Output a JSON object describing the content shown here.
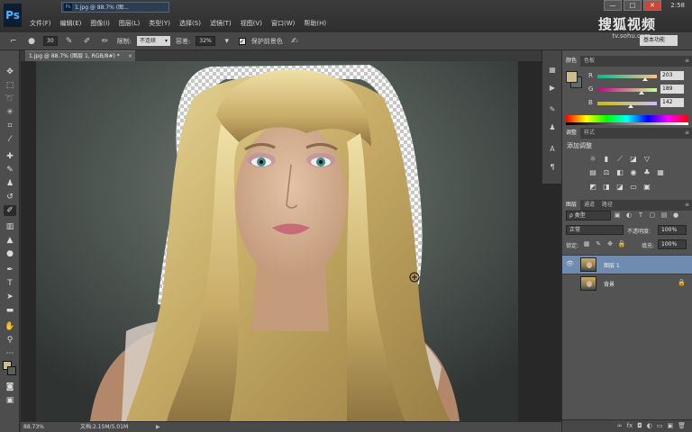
{
  "app": {
    "logo": "Ps",
    "clock": "2:58"
  },
  "menu": [
    "文件(F)",
    "编辑(E)",
    "图像(I)",
    "图层(L)",
    "类型(Y)",
    "选择(S)",
    "滤镜(T)",
    "视图(V)",
    "窗口(W)",
    "帮助(H)"
  ],
  "top_doc_tab": "1.jpg @ 88.7% (图...",
  "watermark": {
    "logo": "搜狐视频",
    "url": "tv.sohu.com"
  },
  "window_buttons": {
    "minimize": "—",
    "maximize": "□",
    "close": "✕"
  },
  "options_bar": {
    "brush_size": "30",
    "limits_label": "限制:",
    "limits_value": "不连续",
    "tolerance_label": "容差:",
    "tolerance_value": "32%",
    "protect_fg_label": "保护前景色",
    "workspace": "基本功能"
  },
  "document_tab": {
    "title": "1.jpg @ 88.7% (图层 1, RGB/8#) *",
    "close": "×"
  },
  "status_bar": {
    "zoom": "88.73%",
    "doc_size": "文档:2.15M/5.01M",
    "arrow": "▶"
  },
  "color_panel": {
    "tabs": [
      "颜色",
      "色板"
    ],
    "fg_color": "#cbbd8e",
    "bg_color": "#5d6a6a",
    "channels": [
      {
        "name": "R",
        "value": "203",
        "fraction": 0.796
      },
      {
        "name": "G",
        "value": "189",
        "fraction": 0.741
      },
      {
        "name": "B",
        "value": "142",
        "fraction": 0.557
      }
    ]
  },
  "adjust_panel": {
    "tabs": [
      "调整",
      "样式"
    ],
    "title": "添加调整"
  },
  "layers_panel": {
    "tabs": [
      "图层",
      "通道",
      "路径"
    ],
    "filter": "ρ 类型",
    "blend_mode": "正常",
    "opacity_label": "不透明度:",
    "opacity_value": "100%",
    "lock_label": "锁定:",
    "fill_label": "填充:",
    "fill_value": "100%",
    "layers": [
      {
        "name": "图层 1",
        "visible": true,
        "selected": true,
        "locked": false
      },
      {
        "name": "背景",
        "visible": false,
        "selected": false,
        "locked": true
      }
    ]
  }
}
